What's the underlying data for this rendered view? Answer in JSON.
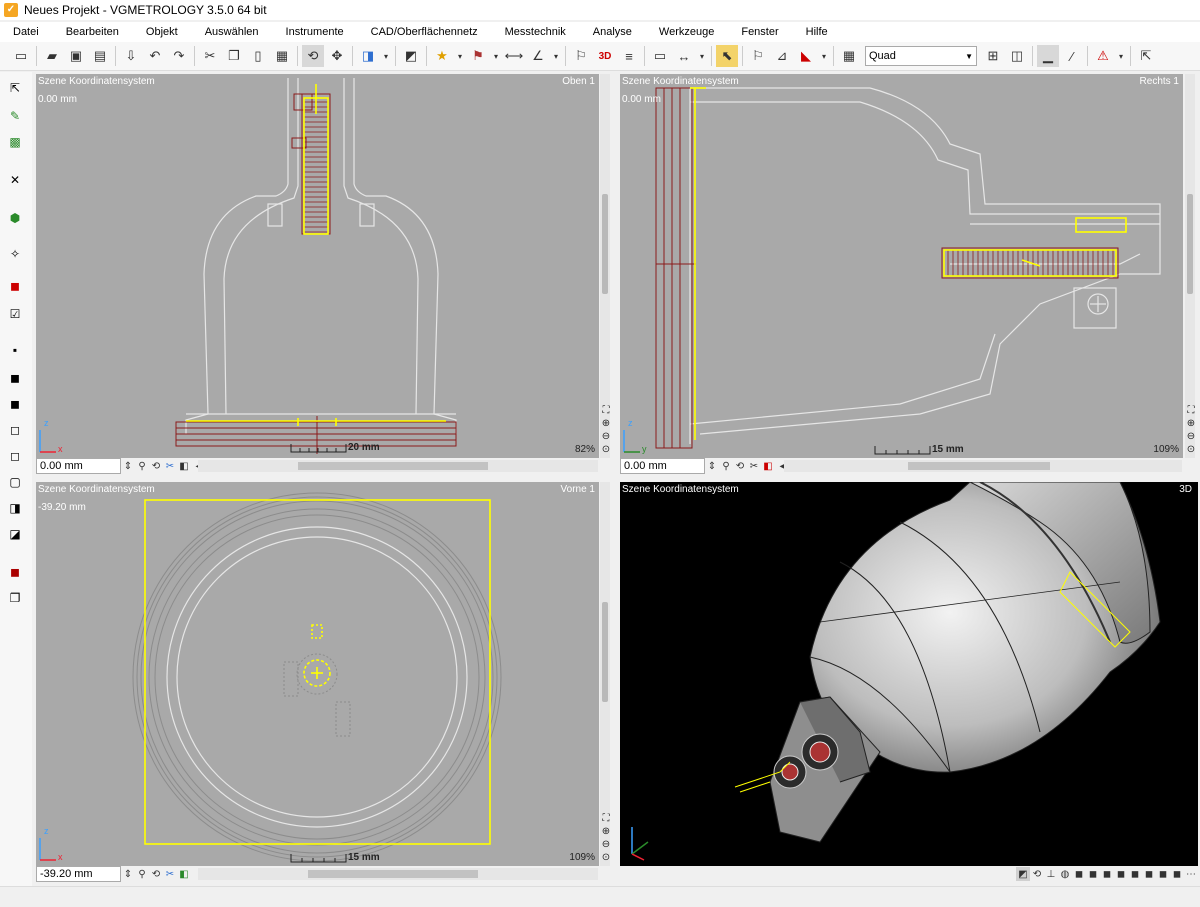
{
  "window": {
    "title": "Neues Projekt  - VGMETROLOGY 3.5.0 64 bit"
  },
  "menu": [
    "Datei",
    "Bearbeiten",
    "Objekt",
    "Auswählen",
    "Instrumente",
    "CAD/Oberflächennetz",
    "Messtechnik",
    "Analyse",
    "Werkzeuge",
    "Fenster",
    "Hilfe"
  ],
  "toolbar": {
    "layout_select": "Quad"
  },
  "viewports": {
    "top_left": {
      "name": "Szene Koordinatensystem",
      "view": "Oben 1",
      "offset": "0.00 mm",
      "scale": "20 mm",
      "zoom": "82%",
      "input": "0.00 mm"
    },
    "top_right": {
      "name": "Szene Koordinatensystem",
      "view": "Rechts 1",
      "offset": "0.00 mm",
      "scale": "15 mm",
      "zoom": "109%",
      "input": "0.00 mm"
    },
    "bottom_left": {
      "name": "Szene Koordinatensystem",
      "view": "Vorne 1",
      "offset": "-39.20 mm",
      "scale": "15 mm",
      "zoom": "109%",
      "input": "-39.20 mm"
    },
    "bottom_right": {
      "name": "Szene Koordinatensystem",
      "view": "3D"
    }
  },
  "axes": {
    "x": "x",
    "y": "y",
    "z": "z"
  },
  "colors": {
    "viewport_bg": "#a9a9a9",
    "outline": "#e6e6e6",
    "selection": "#ffff00",
    "feature": "#8b1a1a",
    "bg3d": "#000000"
  }
}
